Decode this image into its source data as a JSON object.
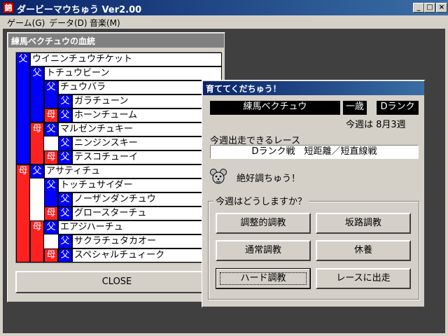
{
  "window": {
    "icon_text": "錦",
    "title": "ダービーマウちゅう Ver2.00",
    "menus": [
      "ゲーム(G)",
      "データ(D)",
      "音楽(M)"
    ]
  },
  "pedigree": {
    "title": "練馬ベクチュウの血統",
    "sire_label": "父",
    "dam_label": "母",
    "names": {
      "s": "ウイニンチュウチケット",
      "ss": "トチュウビーン",
      "sss": "チュウバラ",
      "ssss": "ガラチューン",
      "sssd": "ホーンチューム",
      "ssd": "マルゼンチュキー",
      "ssds": "ニンジンスキー",
      "ssdd": "テスコチューイ",
      "d": "アサティチュ",
      "ds": "トッチュサイダー",
      "dss": "ノーザンダンチュウ",
      "dsd": "グロースターチュ",
      "dd": "エアジハーチュ",
      "dds": "サクラチュタカオー",
      "ddd": "スペシャルチュィーク"
    },
    "close_label": "CLOSE"
  },
  "dialog": {
    "title": "育ててくだちゅう！",
    "horse_name": "練馬ベクチュウ",
    "age": "一歳",
    "rank": "Dランク",
    "week": "今週は 8月3週",
    "race_label": "今週出走できるレース",
    "race_value": "Dランク戦　短距離／短直線戦",
    "mouse_icon": "mouse-face-icon",
    "status": "絶好調ちゅう！",
    "question": "今週はどうしますか？",
    "buttons": {
      "adjust": "調整的調教",
      "slope": "坂路調教",
      "normal": "通常調教",
      "rest": "休養",
      "hard": "ハード調教",
      "race": "レースに出走"
    }
  },
  "colors": {
    "sire": "#0000ff",
    "dam": "#ff2020",
    "title_bar": "#0a246a"
  }
}
